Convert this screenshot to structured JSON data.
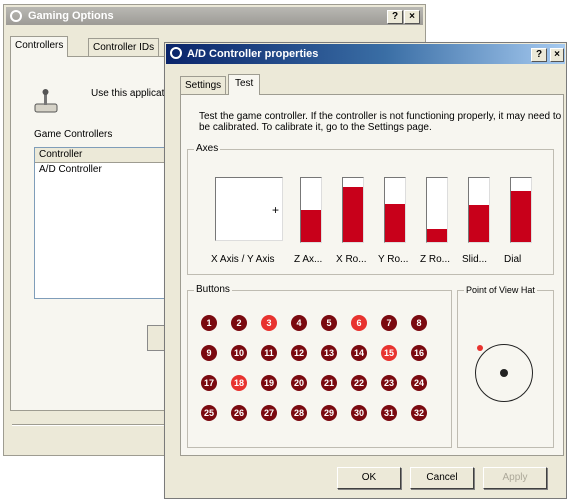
{
  "back_window": {
    "title": "Gaming Options",
    "help_btn": "?",
    "close_btn": "×",
    "tabs": [
      "Controllers",
      "Controller IDs"
    ],
    "use_text": "Use this applicat",
    "game_controllers_label": "Game Controllers",
    "list_header": "Controller",
    "list_items": [
      "A/D Controller"
    ]
  },
  "front_window": {
    "title": "A/D Controller properties",
    "help_btn": "?",
    "close_btn": "×",
    "tabs": [
      "Settings",
      "Test"
    ],
    "description": "Test the game controller.  If the controller is not functioning properly, it may need to be calibrated.  To calibrate it, go to the Settings page.",
    "axes_group": "Axes",
    "xy_label": "X Axis / Y Axis",
    "axes": [
      {
        "label": "Z Ax...",
        "level": 0.5
      },
      {
        "label": "X Ro...",
        "level": 0.86
      },
      {
        "label": "Y Ro...",
        "level": 0.6
      },
      {
        "label": "Z Ro...",
        "level": 0.2
      },
      {
        "label": "Slid...",
        "level": 0.58
      },
      {
        "label": "Dial",
        "level": 0.8
      }
    ],
    "buttons_group": "Buttons",
    "buttons": [
      {
        "n": "1",
        "on": false
      },
      {
        "n": "2",
        "on": false
      },
      {
        "n": "3",
        "on": true
      },
      {
        "n": "4",
        "on": false
      },
      {
        "n": "5",
        "on": false
      },
      {
        "n": "6",
        "on": true
      },
      {
        "n": "7",
        "on": false
      },
      {
        "n": "8",
        "on": false
      },
      {
        "n": "9",
        "on": false
      },
      {
        "n": "10",
        "on": false
      },
      {
        "n": "11",
        "on": false
      },
      {
        "n": "12",
        "on": false
      },
      {
        "n": "13",
        "on": false
      },
      {
        "n": "14",
        "on": false
      },
      {
        "n": "15",
        "on": true
      },
      {
        "n": "16",
        "on": false
      },
      {
        "n": "17",
        "on": false
      },
      {
        "n": "18",
        "on": true
      },
      {
        "n": "19",
        "on": false
      },
      {
        "n": "20",
        "on": false
      },
      {
        "n": "21",
        "on": false
      },
      {
        "n": "22",
        "on": false
      },
      {
        "n": "23",
        "on": false
      },
      {
        "n": "24",
        "on": false
      },
      {
        "n": "25",
        "on": false
      },
      {
        "n": "26",
        "on": false
      },
      {
        "n": "27",
        "on": false
      },
      {
        "n": "28",
        "on": false
      },
      {
        "n": "29",
        "on": false
      },
      {
        "n": "30",
        "on": false
      },
      {
        "n": "31",
        "on": false
      },
      {
        "n": "32",
        "on": false
      }
    ],
    "pov_group": "Point of View Hat",
    "ok": "OK",
    "cancel": "Cancel",
    "apply": "Apply"
  },
  "colors": {
    "axis_fill": "#c8001a",
    "button_off": "#7a0a10",
    "button_on": "#e8332f"
  }
}
